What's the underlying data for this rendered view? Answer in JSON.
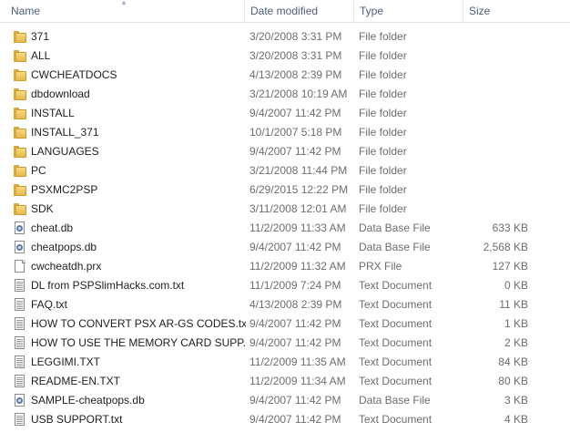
{
  "columns": {
    "name": "Name",
    "date": "Date modified",
    "type": "Type",
    "size": "Size"
  },
  "icons": {
    "folder": "folder-icon",
    "database": "database-file-icon",
    "generic": "file-icon",
    "text": "text-document-icon"
  },
  "files": [
    {
      "name": "371",
      "date": "3/20/2008 3:31 PM",
      "type": "File folder",
      "size": "",
      "icon": "folder"
    },
    {
      "name": "ALL",
      "date": "3/20/2008 3:31 PM",
      "type": "File folder",
      "size": "",
      "icon": "folder"
    },
    {
      "name": "CWCHEATDOCS",
      "date": "4/13/2008 2:39 PM",
      "type": "File folder",
      "size": "",
      "icon": "folder"
    },
    {
      "name": "dbdownload",
      "date": "3/21/2008 10:19 AM",
      "type": "File folder",
      "size": "",
      "icon": "folder"
    },
    {
      "name": "INSTALL",
      "date": "9/4/2007 11:42 PM",
      "type": "File folder",
      "size": "",
      "icon": "folder"
    },
    {
      "name": "INSTALL_371",
      "date": "10/1/2007 5:18 PM",
      "type": "File folder",
      "size": "",
      "icon": "folder"
    },
    {
      "name": "LANGUAGES",
      "date": "9/4/2007 11:42 PM",
      "type": "File folder",
      "size": "",
      "icon": "folder"
    },
    {
      "name": "PC",
      "date": "3/21/2008 11:44 PM",
      "type": "File folder",
      "size": "",
      "icon": "folder"
    },
    {
      "name": "PSXMC2PSP",
      "date": "6/29/2015 12:22 PM",
      "type": "File folder",
      "size": "",
      "icon": "folder"
    },
    {
      "name": "SDK",
      "date": "3/11/2008 12:01 AM",
      "type": "File folder",
      "size": "",
      "icon": "folder"
    },
    {
      "name": "cheat.db",
      "date": "11/2/2009 11:33 AM",
      "type": "Data Base File",
      "size": "633 KB",
      "icon": "database"
    },
    {
      "name": "cheatpops.db",
      "date": "9/4/2007 11:42 PM",
      "type": "Data Base File",
      "size": "2,568 KB",
      "icon": "database"
    },
    {
      "name": "cwcheatdh.prx",
      "date": "11/2/2009 11:32 AM",
      "type": "PRX File",
      "size": "127 KB",
      "icon": "generic"
    },
    {
      "name": "DL from PSPSlimHacks.com.txt",
      "date": "11/1/2009 7:24 PM",
      "type": "Text Document",
      "size": "0 KB",
      "icon": "text"
    },
    {
      "name": "FAQ.txt",
      "date": "4/13/2008 2:39 PM",
      "type": "Text Document",
      "size": "11 KB",
      "icon": "text"
    },
    {
      "name": "HOW TO CONVERT PSX AR-GS CODES.txt",
      "date": "9/4/2007 11:42 PM",
      "type": "Text Document",
      "size": "1 KB",
      "icon": "text"
    },
    {
      "name": "HOW TO USE THE MEMORY CARD SUPP...",
      "date": "9/4/2007 11:42 PM",
      "type": "Text Document",
      "size": "2 KB",
      "icon": "text"
    },
    {
      "name": "LEGGIMI.TXT",
      "date": "11/2/2009 11:35 AM",
      "type": "Text Document",
      "size": "84 KB",
      "icon": "text"
    },
    {
      "name": "README-EN.TXT",
      "date": "11/2/2009 11:34 AM",
      "type": "Text Document",
      "size": "80 KB",
      "icon": "text"
    },
    {
      "name": "SAMPLE-cheatpops.db",
      "date": "9/4/2007 11:42 PM",
      "type": "Data Base File",
      "size": "3 KB",
      "icon": "database"
    },
    {
      "name": "USB SUPPORT.txt",
      "date": "9/4/2007 11:42 PM",
      "type": "Text Document",
      "size": "4 KB",
      "icon": "text"
    }
  ]
}
